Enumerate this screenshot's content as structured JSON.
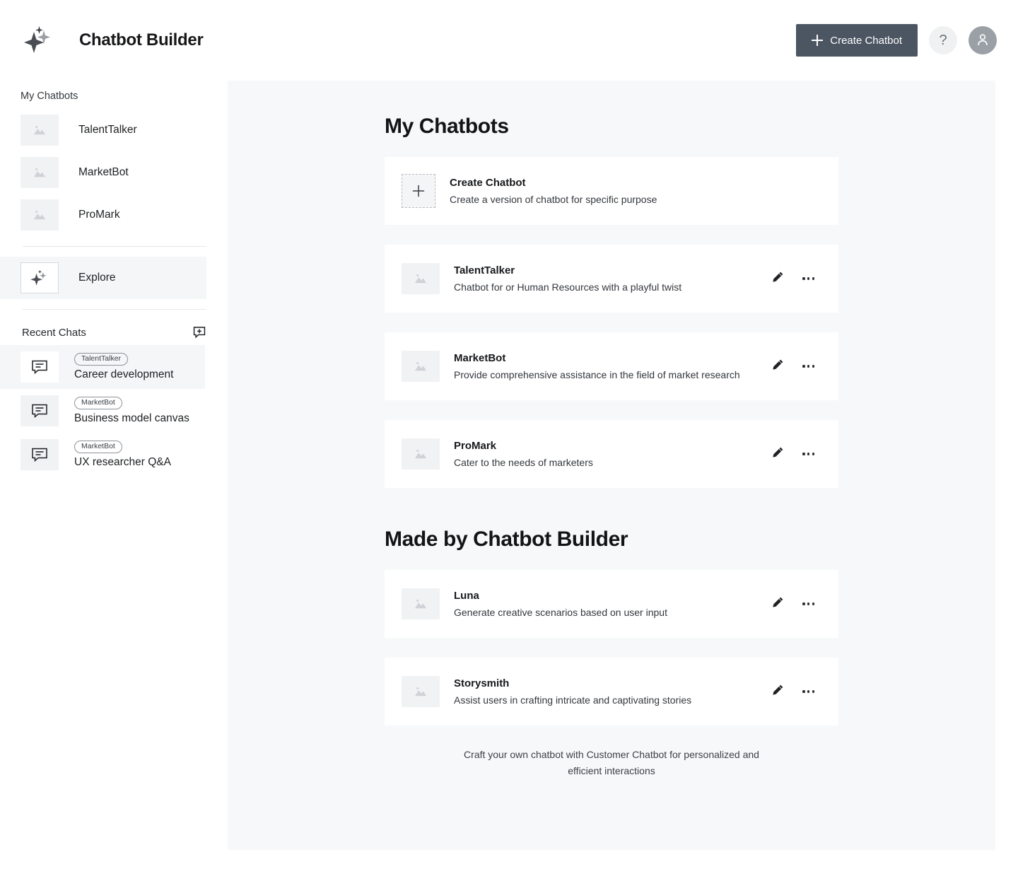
{
  "header": {
    "title": "Chatbot Builder",
    "logo_icon": "sparkle-icon",
    "create_button": {
      "label": "Create Chatbot",
      "icon": "plus-icon",
      "bg": "#4c5562"
    },
    "help_button": {
      "label": "?",
      "icon": "question-mark-icon"
    },
    "avatar_button": {
      "icon": "user-avatar-icon"
    }
  },
  "sidebar": {
    "my_chatbots_label": "My Chatbots",
    "chatbots": [
      {
        "label": "TalentTalker",
        "icon": "image-placeholder-icon"
      },
      {
        "label": "MarketBot",
        "icon": "image-placeholder-icon"
      },
      {
        "label": "ProMark",
        "icon": "image-placeholder-icon"
      }
    ],
    "explore": {
      "label": "Explore",
      "icon": "sparkle-icon"
    },
    "recent_chats_label": "Recent Chats",
    "new_chat_icon": "new-chat-plus-icon",
    "recent_chats": [
      {
        "tag": "TalentTalker",
        "title": "Career development",
        "icon": "chat-bubble-icon"
      },
      {
        "tag": "MarketBot",
        "title": "Business model canvas",
        "icon": "chat-bubble-icon"
      },
      {
        "tag": "MarketBot",
        "title": "UX researcher Q&A",
        "icon": "chat-bubble-icon"
      }
    ]
  },
  "main": {
    "my_chatbots_heading": "My Chatbots",
    "create_card": {
      "name": "Create Chatbot",
      "desc": "Create a version of chatbot for specific purpose",
      "icon": "plus-icon"
    },
    "my_chatbots": [
      {
        "name": "TalentTalker",
        "desc": "Chatbot for or Human Resources with a playful twist",
        "icon": "image-placeholder-icon",
        "edit_icon": "pencil-icon",
        "more_icon": "ellipsis-icon"
      },
      {
        "name": "MarketBot",
        "desc": "Provide comprehensive assistance in the field of market research",
        "icon": "image-placeholder-icon",
        "edit_icon": "pencil-icon",
        "more_icon": "ellipsis-icon"
      },
      {
        "name": "ProMark",
        "desc": "Cater to the needs of marketers",
        "icon": "image-placeholder-icon",
        "edit_icon": "pencil-icon",
        "more_icon": "ellipsis-icon"
      }
    ],
    "made_by_heading": "Made by Chatbot Builder",
    "made_by": [
      {
        "name": "Luna",
        "desc": "Generate creative scenarios based on user input",
        "icon": "image-placeholder-icon",
        "edit_icon": "pencil-icon",
        "more_icon": "ellipsis-icon"
      },
      {
        "name": "Storysmith",
        "desc": "Assist users in crafting intricate and captivating stories",
        "icon": "image-placeholder-icon",
        "edit_icon": "pencil-icon",
        "more_icon": "ellipsis-icon"
      }
    ],
    "footer_note": "Craft your own chatbot with Customer Chatbot for personalized and efficient interactions"
  },
  "colors": {
    "accent": "#4c5562",
    "panel_bg": "#f7f8fa",
    "card_bg": "#ffffff",
    "thumb_bg": "#f1f2f4"
  }
}
